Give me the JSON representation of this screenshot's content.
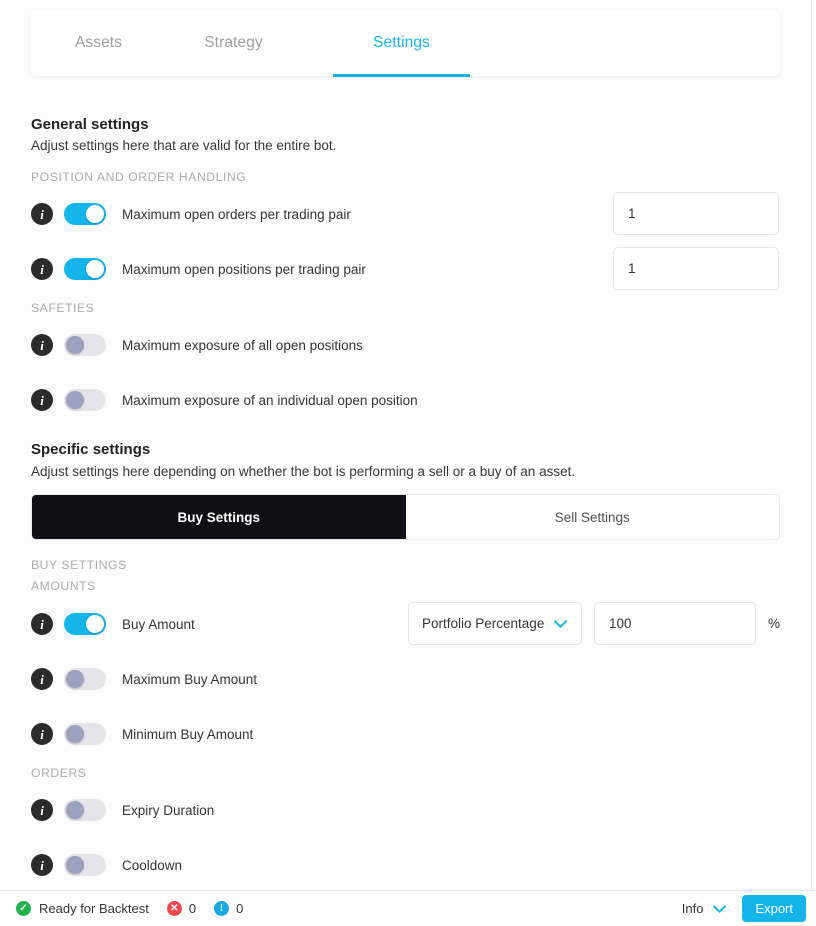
{
  "tabs": [
    {
      "label": "Assets",
      "active": false
    },
    {
      "label": "Strategy",
      "active": false
    },
    {
      "label": "Settings",
      "active": true
    }
  ],
  "general": {
    "title": "General settings",
    "subtitle": "Adjust settings here that are valid for the entire bot.",
    "groups": [
      {
        "label": "POSITION AND ORDER HANDLING",
        "rows": [
          {
            "label": "Maximum open orders per trading pair",
            "enabled": true,
            "value": "1"
          },
          {
            "label": "Maximum open positions per trading pair",
            "enabled": true,
            "value": "1"
          }
        ]
      },
      {
        "label": "SAFETIES",
        "rows": [
          {
            "label": "Maximum exposure of all open positions",
            "enabled": false
          },
          {
            "label": "Maximum exposure of an individual open position",
            "enabled": false
          }
        ]
      }
    ]
  },
  "specific": {
    "title": "Specific settings",
    "subtitle": "Adjust settings here depending on whether the bot is performing a sell or a buy of an asset.",
    "segments": [
      {
        "label": "Buy Settings",
        "active": true
      },
      {
        "label": "Sell Settings",
        "active": false
      }
    ],
    "section_label": "BUY SETTINGS",
    "groups": [
      {
        "label": "AMOUNTS",
        "rows": [
          {
            "label": "Buy Amount",
            "enabled": true,
            "select_value": "Portfolio Percentage",
            "value": "100",
            "suffix": "%"
          },
          {
            "label": "Maximum Buy Amount",
            "enabled": false
          },
          {
            "label": "Minimum Buy Amount",
            "enabled": false
          }
        ]
      },
      {
        "label": "ORDERS",
        "rows": [
          {
            "label": "Expiry Duration",
            "enabled": false
          },
          {
            "label": "Cooldown",
            "enabled": false
          }
        ]
      }
    ]
  },
  "statusbar": {
    "status_text": "Ready for Backtest",
    "error_count": "0",
    "info_count": "0",
    "info_dropdown_label": "Info",
    "export_label": "Export"
  },
  "colors": {
    "accent": "#13b5ea",
    "active_tab_dark": "#0d1117",
    "success": "#22b14c",
    "error": "#f0484f",
    "info": "#17a9e0"
  }
}
